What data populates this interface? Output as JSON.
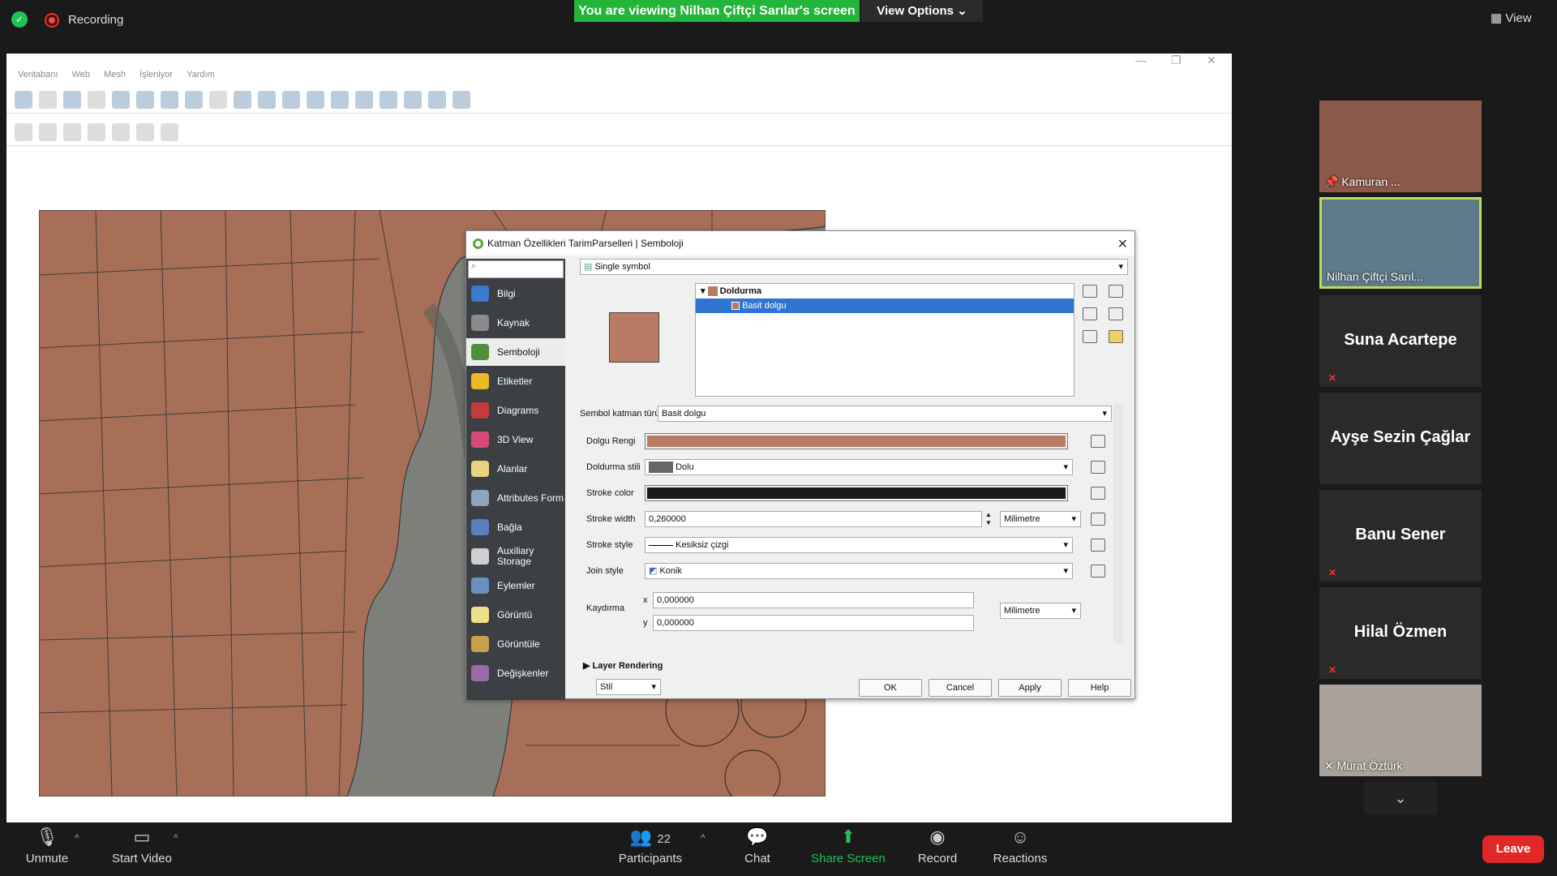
{
  "top": {
    "recording": "Recording",
    "viewing": "You are viewing Nilhan Çiftçi Sarılar's screen",
    "view_options": "View Options",
    "view": "View"
  },
  "qgis": {
    "menus": [
      "Veritabanı",
      "Web",
      "Mesh",
      "İşleniyor",
      "Yardım"
    ]
  },
  "dialog": {
    "title": "Katman Özellikleri  TarimParselleri | Semboloji",
    "renderer": "Single symbol",
    "side_items": [
      "Bilgi",
      "Kaynak",
      "Semboloji",
      "Etiketler",
      "Diagrams",
      "3D View",
      "Alanlar",
      "Attributes Form",
      "Bağla",
      "Auxiliary Storage",
      "Eylemler",
      "Görüntü",
      "Görüntüle",
      "Değişkenler"
    ],
    "tree_root": "Doldurma",
    "tree_child": "Basit dolgu",
    "layer_type_label": "Sembol katman türü",
    "layer_type": "Basit dolgu",
    "fill_color_label": "Dolgu Rengi",
    "fill_color": "#b87c64",
    "fill_style_label": "Doldurma stili",
    "fill_style": "Dolu",
    "stroke_color_label": "Stroke color",
    "stroke_color": "#1a1a1a",
    "stroke_width_label": "Stroke width",
    "stroke_width": "0,260000",
    "stroke_unit": "Milimetre",
    "stroke_style_label": "Stroke style",
    "stroke_style": "Kesiksiz çizgi",
    "join_style_label": "Join style",
    "join_style": "Konik",
    "offset_label": "Kaydırma",
    "x_label": "x",
    "x_val": "0,000000",
    "y_label": "y",
    "y_val": "0,000000",
    "offset_unit": "Milimetre",
    "layer_rendering": "Layer Rendering",
    "stil": "Stil",
    "ok": "OK",
    "cancel": "Cancel",
    "apply": "Apply",
    "help": "Help"
  },
  "participants": [
    {
      "name": "Kamuran ...",
      "type": "video"
    },
    {
      "name": "Nilhan Çiftçi Sarıl...",
      "type": "video",
      "active": true
    },
    {
      "name": "Suna Acartepe",
      "type": "name"
    },
    {
      "name": "Ayşe Sezin Çağlar",
      "type": "name"
    },
    {
      "name": "Banu Sener",
      "type": "name"
    },
    {
      "name": "Hilal Özmen",
      "type": "name"
    },
    {
      "name": "Murat Öztürk",
      "type": "video"
    }
  ],
  "bottom": {
    "unmute": "Unmute",
    "start_video": "Start Video",
    "participants": "Participants",
    "participant_count": "22",
    "chat": "Chat",
    "share": "Share Screen",
    "record": "Record",
    "reactions": "Reactions",
    "leave": "Leave"
  }
}
